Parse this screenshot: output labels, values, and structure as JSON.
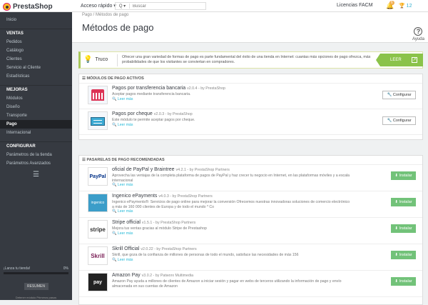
{
  "topbar": {
    "logo": "PrestaShop",
    "quick_access": "Acceso rápido ▾",
    "search_icon": "Q ▾",
    "search_placeholder": "Buscar",
    "shop_name": "Licencias FACM",
    "notif_count": "6",
    "trophy": "12"
  },
  "sidebar": {
    "items": [
      {
        "label": "Inicio"
      },
      {
        "head": "VENTAS"
      },
      {
        "label": "Pedidos"
      },
      {
        "label": "Catálogo"
      },
      {
        "label": "Clientes"
      },
      {
        "label": "Servicio al Cliente"
      },
      {
        "label": "Estadísticas"
      },
      {
        "head": "MEJORAS"
      },
      {
        "label": "Módulos"
      },
      {
        "label": "Diseño"
      },
      {
        "label": "Transporte"
      },
      {
        "label": "Pago",
        "state": "active"
      },
      {
        "label": "Internacional"
      },
      {
        "head": "CONFIGURAR"
      },
      {
        "label": "Parámetros de la tienda"
      },
      {
        "label": "Parámetros Avanzados"
      }
    ],
    "progress_label": "¡Lanza tu tienda!",
    "progress_value": "0%",
    "progress": 0,
    "resumen": "RESUMEN",
    "deactivate": "Detener módulo Primeros pasos"
  },
  "header": {
    "breadcrumb": "Pago  /  Métodos de pago",
    "title": "Métodos de pago",
    "help": "Ayuda"
  },
  "tip": {
    "label": "Truco",
    "text": "Ofrecer una gran variedad de formas de pago es parte fundamental del éxito de una tienda en Internet: cuantas más opciones de pago ofrezca, más probabilidades de que los visitantes se conviertan en compradores.",
    "leer": "LEER"
  },
  "active": {
    "title": "MÓDULOS DE PAGO ACTIVOS",
    "modules": [
      {
        "name": "Pagos por transferencia bancaria",
        "ver": "v2.0.4 - by PrestaShop",
        "desc": "Aceptar pagos mediante transferencia bancaria.",
        "more": "Leer más",
        "btn": "Configurar"
      },
      {
        "name": "Pagos por cheque",
        "ver": "v2.0.3 - by PrestaShop",
        "desc": "Este módulo te permite aceptar pagos por cheque.",
        "more": "Leer más",
        "btn": "Configurar"
      }
    ]
  },
  "recommended": {
    "title": "PASARELAS DE PAGO RECOMENDADAS",
    "modules": [
      {
        "name": "oficial de PayPal y Braintree",
        "ver": "v4.2.1 - by PrestaShop Partners",
        "desc": "Aprovecha las ventajas de la completa plataforma de pagos de PayPal y haz crecer tu negocio en Internet, en las plataformas móviles y a escala internacional",
        "more": "Leer más",
        "btn": "Instalar",
        "logo": "PayPal"
      },
      {
        "name": "Ingenico ePayments",
        "ver": "v4.0.3 - by PrestaShop Partners",
        "desc": "Ingenico ePayments®: Servicios de pago online para mejorar la conversión Ofrecemos nuestras innovadoras soluciones de comercio electrónico a más de 160 000 clientes de Europa y de todo el mundo * Co",
        "more": "Leer más",
        "btn": "Instalar",
        "logo": "ingenico"
      },
      {
        "name": "Stripe official",
        "ver": "v1.5.1 - by PrestaShop Partners",
        "desc": "Mejora tus ventas gracias al módulo Stripe de Prestashop",
        "more": "Leer más",
        "btn": "Instalar",
        "logo": "stripe"
      },
      {
        "name": "Skrill Official",
        "ver": "v2.0.22 - by PrestaShop Partners",
        "desc": "Skrill, que goza de la confianza de millones de personas de todo el mundo, satisface las necesidades de más 156",
        "more": "Leer más",
        "btn": "Instalar",
        "logo": "Skrill"
      },
      {
        "name": "Amazon Pay",
        "ver": "v3.0.2 - by Patworx Multimedia",
        "desc": "Amazon Pay ayuda a millones de clientes de Amazon a iniciar sesión y pagar en webs de terceros utilizando la información de pago y envío almacenada en sus cuentas de Amazon",
        "more": "",
        "btn": "Instalar",
        "logo": "pay"
      }
    ]
  },
  "colors": {
    "accent": "#25b9d7",
    "install": "#72c279",
    "sidebar": "#363a41"
  }
}
